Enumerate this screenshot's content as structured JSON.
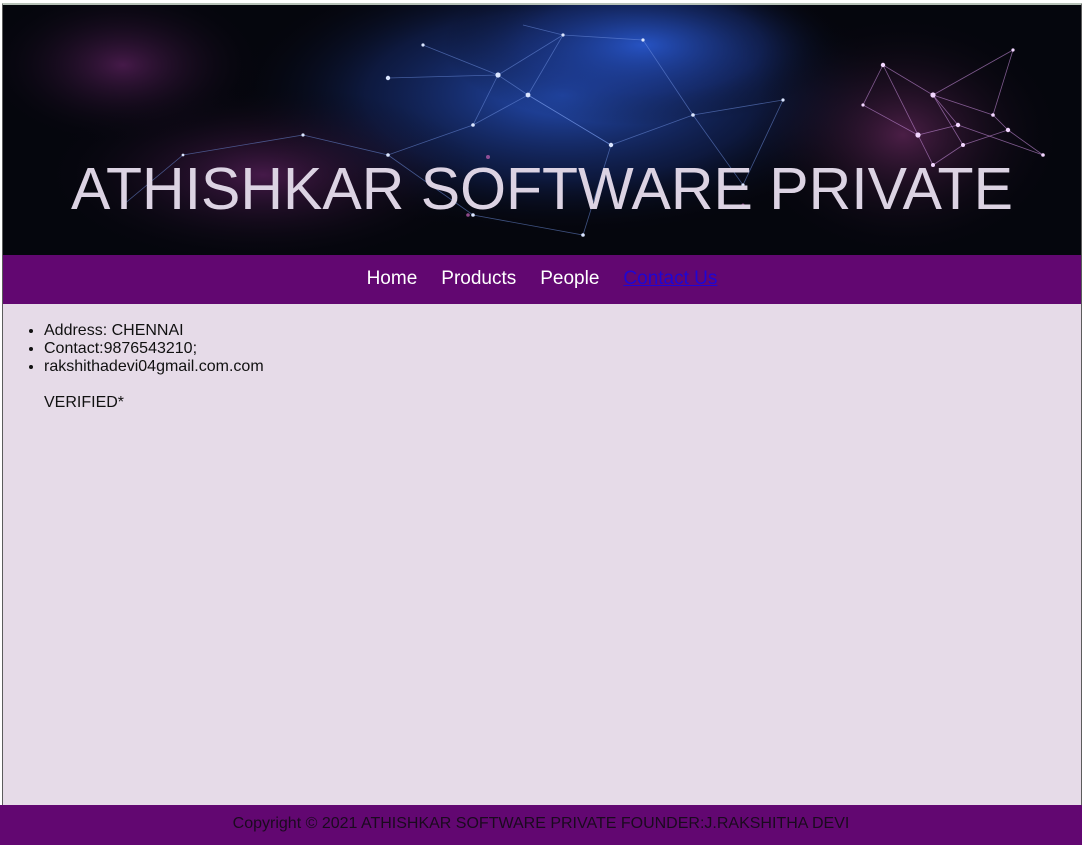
{
  "banner": {
    "title": "ATHISHKAR SOFTWARE PRIVATE"
  },
  "nav": {
    "items": [
      {
        "label": "Home"
      },
      {
        "label": "Products"
      },
      {
        "label": "People"
      },
      {
        "label": "Contact Us"
      }
    ],
    "active": "Contact Us"
  },
  "contact": {
    "items": [
      {
        "text": "Address: CHENNAI"
      },
      {
        "text": "Contact:9876543210;"
      },
      {
        "text": "rakshithadevi04gmail.com.com"
      }
    ],
    "verified": "VERIFIED*"
  },
  "footer": {
    "text": "Copyright © 2021 ATHISHKAR SOFTWARE PRIVATE FOUNDER:J.RAKSHITHA DEVI"
  },
  "colors": {
    "nav_background": "#620771",
    "content_background": "#e6dbe8",
    "banner_background": "#06070f",
    "active_link": "#1f06d4",
    "title_text": "#dcd3e3"
  }
}
